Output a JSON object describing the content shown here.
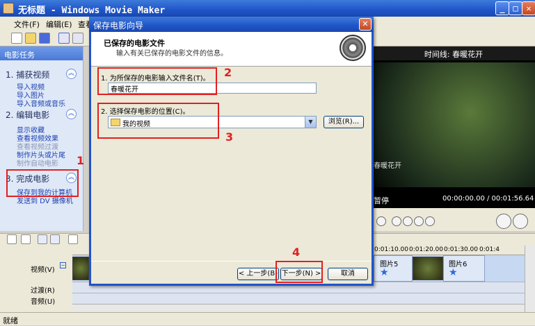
{
  "window": {
    "title": "无标题 - Windows Movie Maker"
  },
  "menubar": [
    "文件(F)",
    "编辑(E)",
    "查看"
  ],
  "taskpane": {
    "header": "电影任务",
    "sections": [
      {
        "title": "1. 捕获视频",
        "links": [
          "导入视频",
          "导入图片",
          "导入音频或音乐"
        ]
      },
      {
        "title": "2. 编辑电影",
        "links": [
          "显示收藏",
          "查看视频效果",
          "查看视频过渡",
          "制作片头或片尾",
          "制作自动电影"
        ]
      },
      {
        "title": "3. 完成电影",
        "links": [
          "保存到我的计算机",
          "发送到 DV 摄像机"
        ]
      }
    ]
  },
  "preview": {
    "title": "时间线: 春暖花开",
    "caption": "春暖花开",
    "status": "暂停",
    "time": "00:00:00.00 / 00:01:56.64"
  },
  "dialog": {
    "title": "保存电影向导",
    "header_title": "已保存的电影文件",
    "header_subtitle": "输入有关已保存的电影文件的信息。",
    "filename_label": "1. 为所保存的电影输入文件名(T)。",
    "filename_value": "春暖花开",
    "location_label": "2. 选择保存电影的位置(C)。",
    "location_value": "我的视频",
    "browse_button": "浏览(R)...",
    "back_button": "< 上一步(B)",
    "next_button": "下一步(N) >",
    "cancel_button": "取消"
  },
  "annotations": [
    "1",
    "2",
    "3",
    "4"
  ],
  "timeline": {
    "ruler": [
      "0:01:10.00",
      "0:01:20.00",
      "0:01:30.00",
      "0:01:4"
    ],
    "tracks": {
      "video": "视频(V)",
      "transition": "过渡(R)",
      "audio": "音频(U)"
    },
    "clips": [
      "图片5",
      "图片6"
    ]
  },
  "statusbar": "就绪"
}
